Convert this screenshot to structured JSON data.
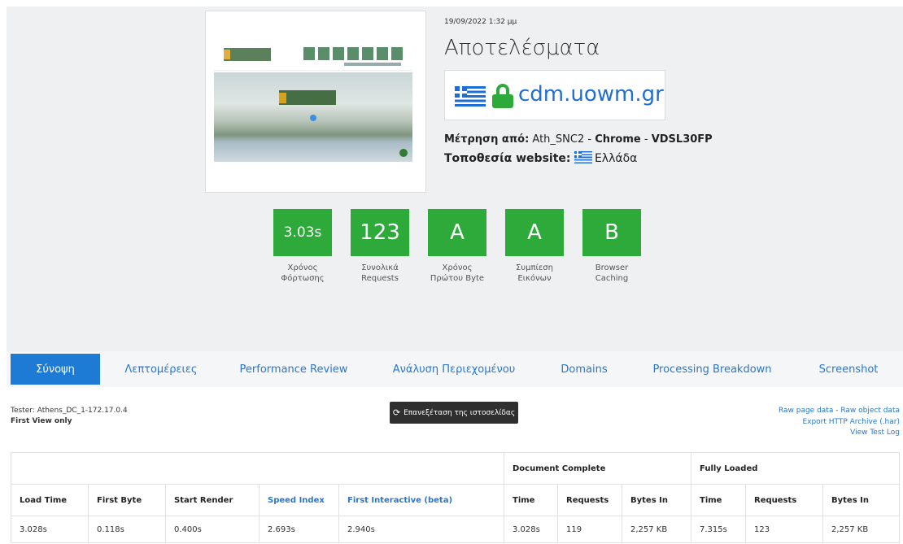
{
  "header": {
    "date": "19/09/2022 1:32 μμ",
    "title": "Αποτελέσματα",
    "url": "cdm.uowm.gr",
    "measure_label": "Μέτρηση από:",
    "measure_location": "Ath_SNC2",
    "sep1": " - ",
    "browser": "Chrome",
    "sep2": " - ",
    "connection": "VDSL30FP",
    "site_location_label": "Τοποθεσία website:",
    "site_location": "Ελλάδα"
  },
  "scores": [
    {
      "value": "3.03s",
      "label1": "Χρόνος",
      "label2": "Φόρτωσης"
    },
    {
      "value": "123",
      "label1": "Συνολικά",
      "label2": "Requests"
    },
    {
      "value": "A",
      "label1": "Χρόνος",
      "label2": "Πρώτου Byte"
    },
    {
      "value": "A",
      "label1": "Συμπίεση",
      "label2": "Εικόνων"
    },
    {
      "value": "B",
      "label1": "Browser",
      "label2": "Caching"
    }
  ],
  "tabs": [
    "Σύνοψη",
    "Λεπτομέρειες",
    "Performance Review",
    "Ανάλυση Περιεχομένου",
    "Domains",
    "Processing Breakdown",
    "Screenshot"
  ],
  "info": {
    "tester": "Tester: Athens_DC_1-172.17.0.4",
    "view": "First View only",
    "retest": "Επανεξέταση της ιστοσελίδας",
    "raw_page": "Raw page data",
    "links_sep": " - ",
    "raw_object": "Raw object data",
    "export_har": "Export HTTP Archive (.har)",
    "test_log": "View Test Log"
  },
  "table": {
    "group_doc": "Document Complete",
    "group_full": "Fully Loaded",
    "headers": [
      "Load Time",
      "First Byte",
      "Start Render",
      "Speed Index",
      "First Interactive (beta)",
      "Time",
      "Requests",
      "Bytes In",
      "Time",
      "Requests",
      "Bytes In"
    ],
    "row": [
      "3.028s",
      "0.118s",
      "0.400s",
      "2.693s",
      "2.940s",
      "3.028s",
      "119",
      "2,257 KB",
      "7.315s",
      "123",
      "2,257 KB"
    ]
  },
  "colors": {
    "grade_green": "#2eaa3a",
    "tab_active": "#1d7bd6",
    "link_blue": "#2a77c9",
    "hero_bg": "#eef0f2"
  },
  "icons": [
    "lock-icon",
    "greek-flag-icon",
    "refresh-icon"
  ]
}
